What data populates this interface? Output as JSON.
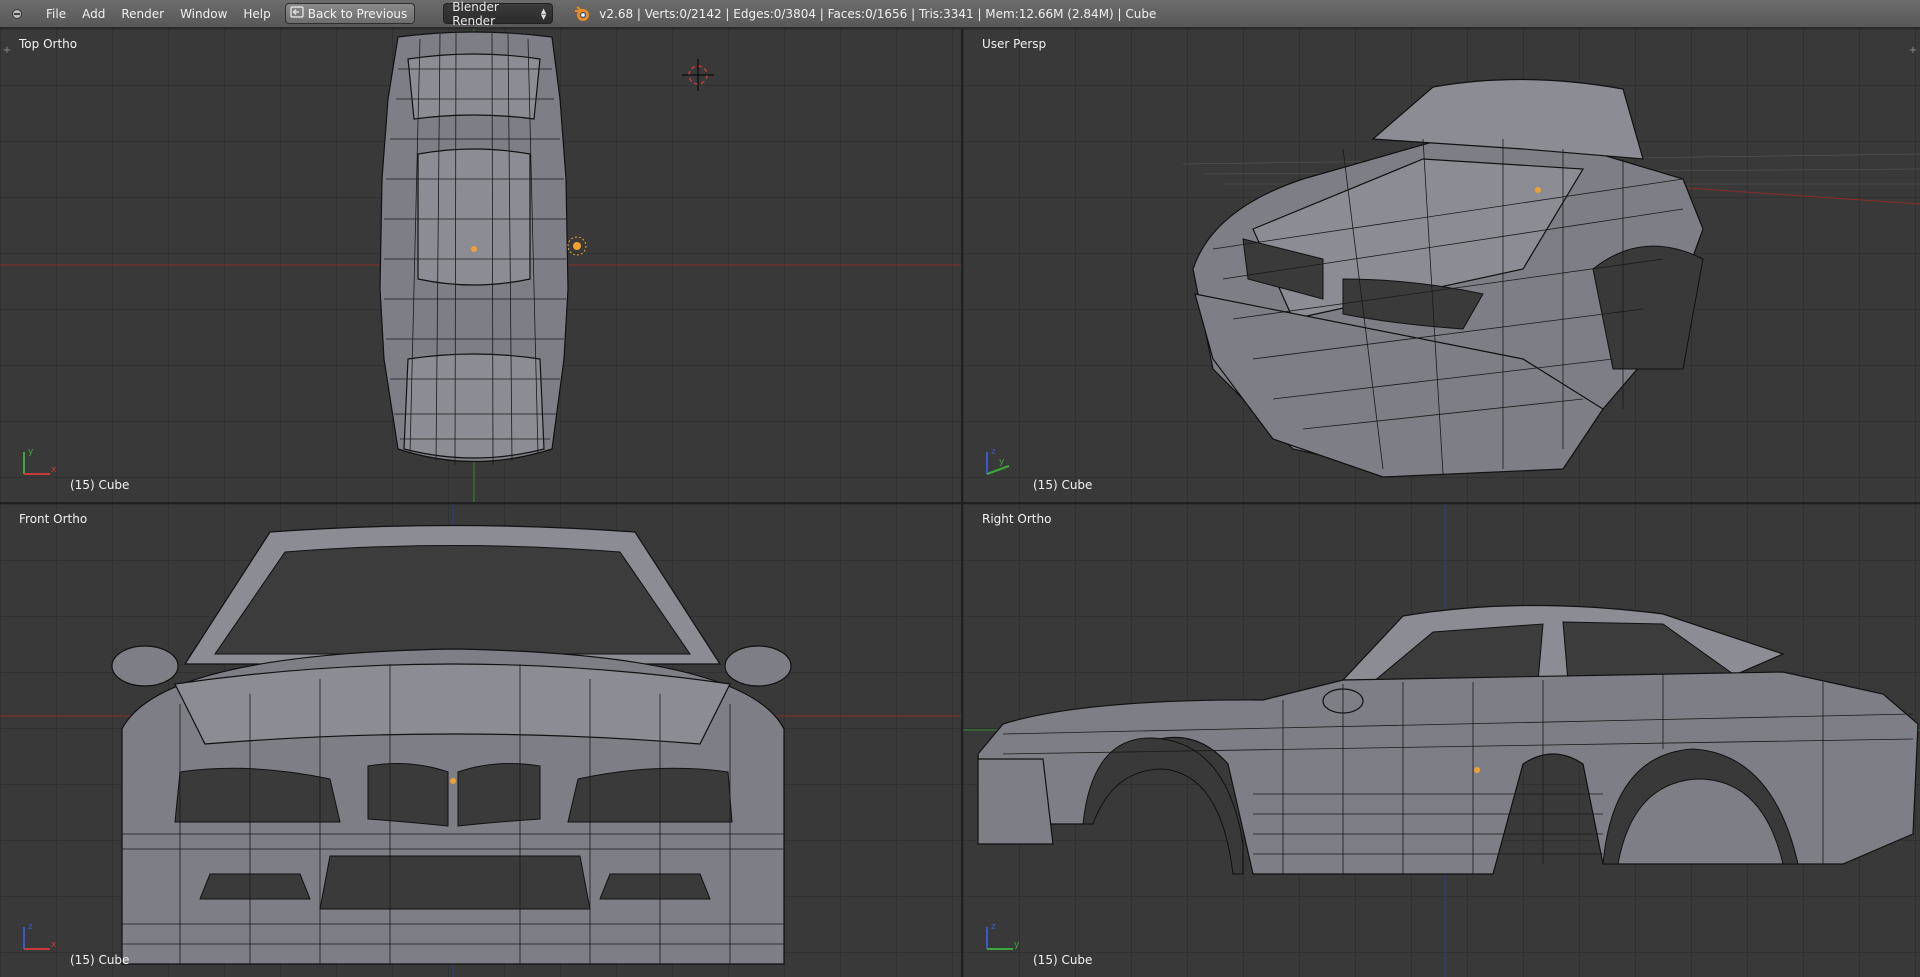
{
  "header": {
    "menus": [
      "File",
      "Add",
      "Render",
      "Window",
      "Help"
    ],
    "back_button": "Back to Previous",
    "render_engine": "Blender Render",
    "stats": "v2.68 | Verts:0/2142 | Edges:0/3804 | Faces:0/1656 | Tris:3341 | Mem:12.66M (2.84M) | Cube",
    "icons": {
      "editor": "info-editor-icon",
      "back": "screen-back-icon",
      "blender": "blender-logo-icon"
    }
  },
  "viewports": [
    {
      "id": "top",
      "view_name": "Top Ortho",
      "object_label": "(15) Cube",
      "axes": [
        "y",
        "x"
      ]
    },
    {
      "id": "persp",
      "view_name": "User Persp",
      "object_label": "(15) Cube",
      "axes": [
        "z",
        "y"
      ]
    },
    {
      "id": "front",
      "view_name": "Front Ortho",
      "object_label": "(15) Cube",
      "axes": [
        "z",
        "x"
      ]
    },
    {
      "id": "right",
      "view_name": "Right Ortho",
      "object_label": "(15) Cube",
      "axes": [
        "z",
        "y"
      ]
    }
  ],
  "colors": {
    "x_axis": "#c83a3a",
    "y_axis": "#3aa83a",
    "z_axis": "#3a5ac8",
    "origin": "#f0a030",
    "viewport_bg": "#393939"
  }
}
